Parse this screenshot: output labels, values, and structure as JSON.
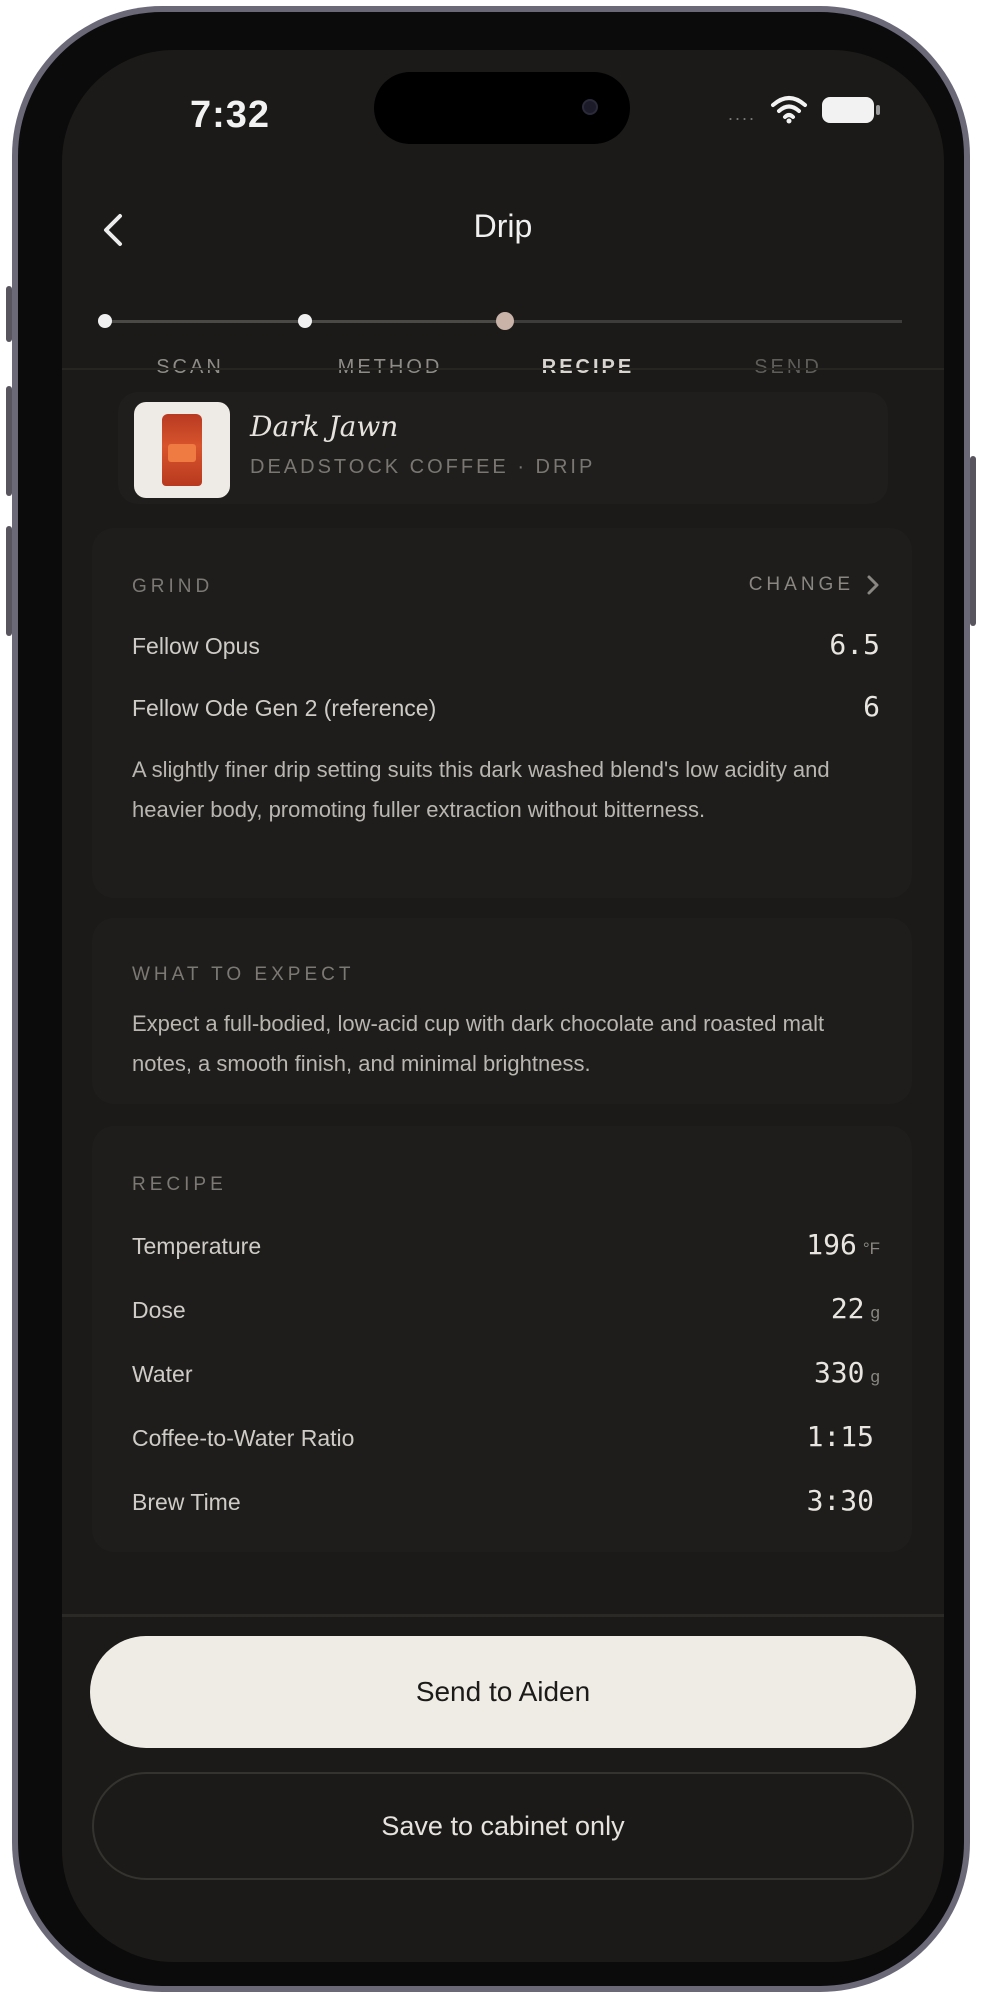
{
  "status_bar": {
    "time": "7:32",
    "signal": "....",
    "wifi_icon": "wifi-icon",
    "battery_icon": "battery-icon"
  },
  "nav": {
    "title": "Drip",
    "back_icon": "chevron-left-icon"
  },
  "stepper": {
    "steps": [
      {
        "label": "SCAN",
        "state": "done"
      },
      {
        "label": "METHOD",
        "state": "done"
      },
      {
        "label": "RECIPE",
        "state": "current"
      },
      {
        "label": "SEND",
        "state": "upcoming"
      }
    ]
  },
  "bean": {
    "name": "Dark Jawn",
    "subtitle": "DEADSTOCK COFFEE · DRIP"
  },
  "grind": {
    "label": "GRIND",
    "change_label": "CHANGE",
    "rows": [
      {
        "label": "Fellow Opus",
        "value": "6.5"
      },
      {
        "label": "Fellow Ode Gen 2 (reference)",
        "value": "6"
      }
    ],
    "description": "A slightly finer drip setting suits this dark washed blend's low acidity and heavier body, promoting fuller extraction without bitterness."
  },
  "expect": {
    "label": "WHAT TO EXPECT",
    "text": "Expect a full-bodied, low-acid cup with dark chocolate and roasted malt notes, a smooth finish, and minimal brightness."
  },
  "recipe": {
    "label": "RECIPE",
    "rows": [
      {
        "label": "Temperature",
        "value": "196",
        "unit": "°F"
      },
      {
        "label": "Dose",
        "value": "22",
        "unit": "g"
      },
      {
        "label": "Water",
        "value": "330",
        "unit": "g"
      },
      {
        "label": "Coffee-to-Water Ratio",
        "value": "1:15",
        "unit": ""
      },
      {
        "label": "Brew Time",
        "value": "3:30",
        "unit": ""
      }
    ]
  },
  "actions": {
    "primary": "Send to Aiden",
    "secondary": "Save to cabinet only"
  },
  "colors": {
    "background": "#1b1a18",
    "card": "#1e1d1b",
    "primary_button": "#efebe5",
    "current_step": "#c9b3a8",
    "bag_orange": "#d8542c"
  }
}
